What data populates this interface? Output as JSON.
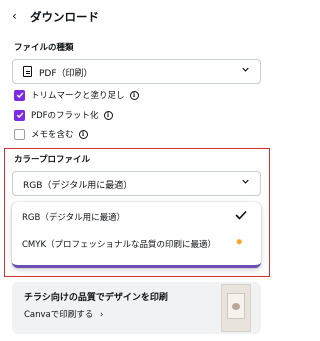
{
  "header": {
    "back_glyph": "‹",
    "title": "ダウンロード"
  },
  "file_type": {
    "label": "ファイルの種類",
    "selected": "PDF（印刷）",
    "icon": "document-icon"
  },
  "options": [
    {
      "label": "トリムマークと塗り足し",
      "checked": true,
      "has_info": true
    },
    {
      "label": "PDFのフラット化",
      "checked": true,
      "has_info": true
    },
    {
      "label": "メモを含む",
      "checked": false,
      "has_info": true
    }
  ],
  "info_glyph": "i",
  "color_profile": {
    "label": "カラープロファイル",
    "selected": "RGB（デジタル用に最適）",
    "options": [
      {
        "label": "RGB（デジタル用に最適）",
        "selected": true
      },
      {
        "label": "CMYK（プロフェッショナルな品質の印刷に最適）",
        "selected": false,
        "badge_glyph": "✸"
      }
    ]
  },
  "promo": {
    "title": "チラシ向けの品質でデザインを印刷",
    "link": "Canvaで印刷する",
    "link_arrow": "›"
  },
  "colors": {
    "accent": "#7d2ae8",
    "highlight_frame": "#d32f2f",
    "premium_star": "#f5a623"
  }
}
